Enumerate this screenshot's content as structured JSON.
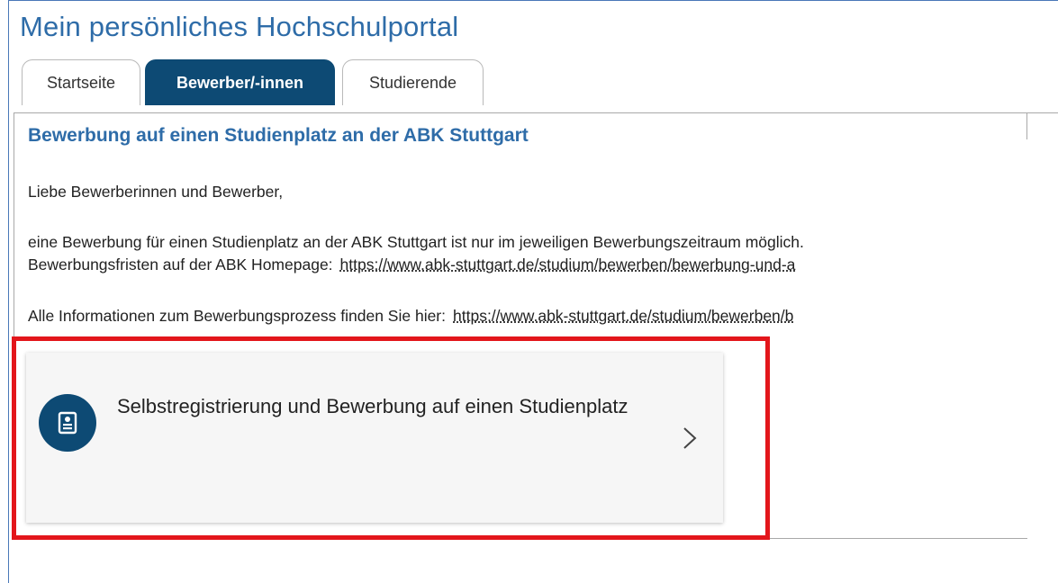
{
  "portal": {
    "title": "Mein persönliches Hochschulportal"
  },
  "tabs": [
    {
      "label": "Startseite",
      "active": false
    },
    {
      "label": "Bewerber/-innen",
      "active": true
    },
    {
      "label": "Studierende",
      "active": false
    }
  ],
  "content": {
    "title": "Bewerbung auf einen Studienplatz an der ABK Stuttgart",
    "greeting": "Liebe Bewerberinnen und Bewerber,",
    "paragraph_line1": "eine Bewerbung für einen Studienplatz an der ABK Stuttgart ist nur im jeweiligen Bewerbungszeitraum möglich.",
    "paragraph_line2_text": "Bewerbungsfristen auf der ABK Homepage:",
    "paragraph_line2_link": "https://www.abk-stuttgart.de/studium/bewerben/bewerbung-und-a",
    "info_text": "Alle Informationen zum Bewerbungsprozess finden Sie hier:",
    "info_link": "https://www.abk-stuttgart.de/studium/bewerben/b"
  },
  "card": {
    "label": "Selbstregistrierung und Bewerbung auf einen Studienplatz",
    "icon": "document-icon",
    "chevron": "chevron-right-icon"
  },
  "colors": {
    "accent": "#2e6ca8",
    "tab_active": "#0d4a74",
    "highlight": "#e3161b"
  }
}
